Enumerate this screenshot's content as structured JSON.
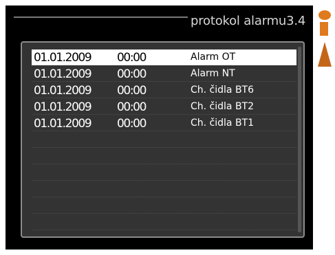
{
  "screen": {
    "title": "protokol alarmu3.4"
  },
  "alarm_log": {
    "rows": [
      {
        "date": "01.01.2009",
        "time": "00:00",
        "event": "Alarm OT",
        "selected": true
      },
      {
        "date": "01.01.2009",
        "time": "00:00",
        "event": "Alarm NT",
        "selected": false
      },
      {
        "date": "01.01.2009",
        "time": "00:00",
        "event": "Ch. čidla BT6",
        "selected": false
      },
      {
        "date": "01.01.2009",
        "time": "00:00",
        "event": "Ch. čidla BT2",
        "selected": false
      },
      {
        "date": "01.01.2009",
        "time": "00:00",
        "event": "Ch. čidla BT1",
        "selected": false
      }
    ],
    "empty_row_count": 6
  },
  "icons": {
    "side": [
      "thermometer-top-icon",
      "thermometer-bottom-icon"
    ]
  },
  "colors": {
    "background": "#000000",
    "panel": "#333333",
    "selected_row": "#ffffff",
    "accent": "#e07a1e"
  }
}
